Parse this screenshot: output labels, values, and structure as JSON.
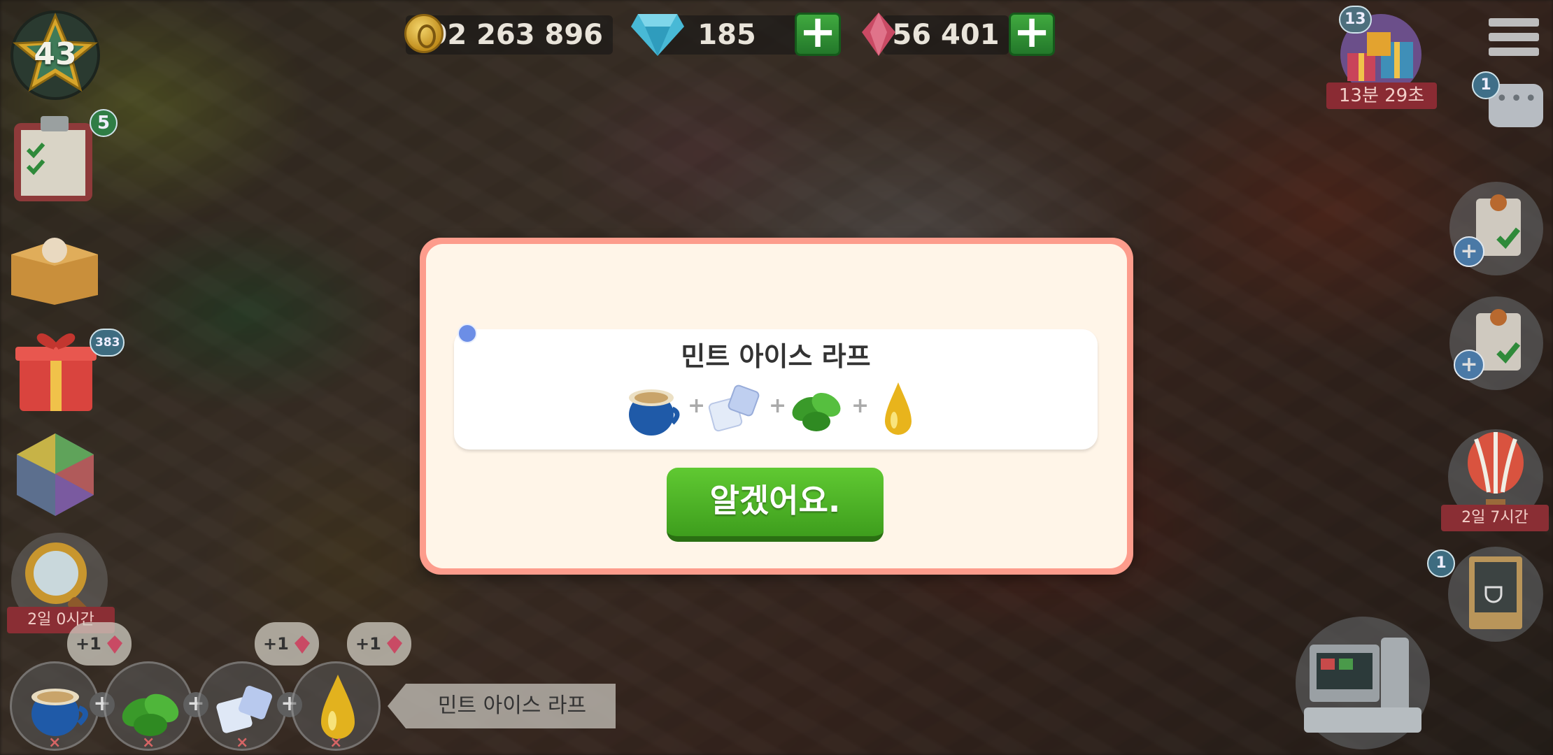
{
  "hud": {
    "level": "43",
    "coins": "402 263 896",
    "gems": "185",
    "rubies": "56 401",
    "plus_label": "+",
    "event_count": "13",
    "event_timer": "13분 29초",
    "chat_count": "1"
  },
  "left_panel": {
    "orders_count": "5",
    "gifts_count": "383",
    "search_timer": "2일 0시간"
  },
  "right_panel": {
    "balloon_timer": "2일 7시간",
    "board_count": "1"
  },
  "bottom_bar": {
    "bubble_label": "+1",
    "slot_remove": "×",
    "slot_plus": "+",
    "recipe_name": "민트 아이스 라프"
  },
  "dialog": {
    "recipe_title": "민트 아이스 라프",
    "ingredients": [
      "coffee-cup-icon",
      "ice-cubes-icon",
      "mint-leaves-icon",
      "syrup-drop-icon"
    ],
    "ingredient_plus": "+",
    "ok_label": "알겠어요."
  }
}
